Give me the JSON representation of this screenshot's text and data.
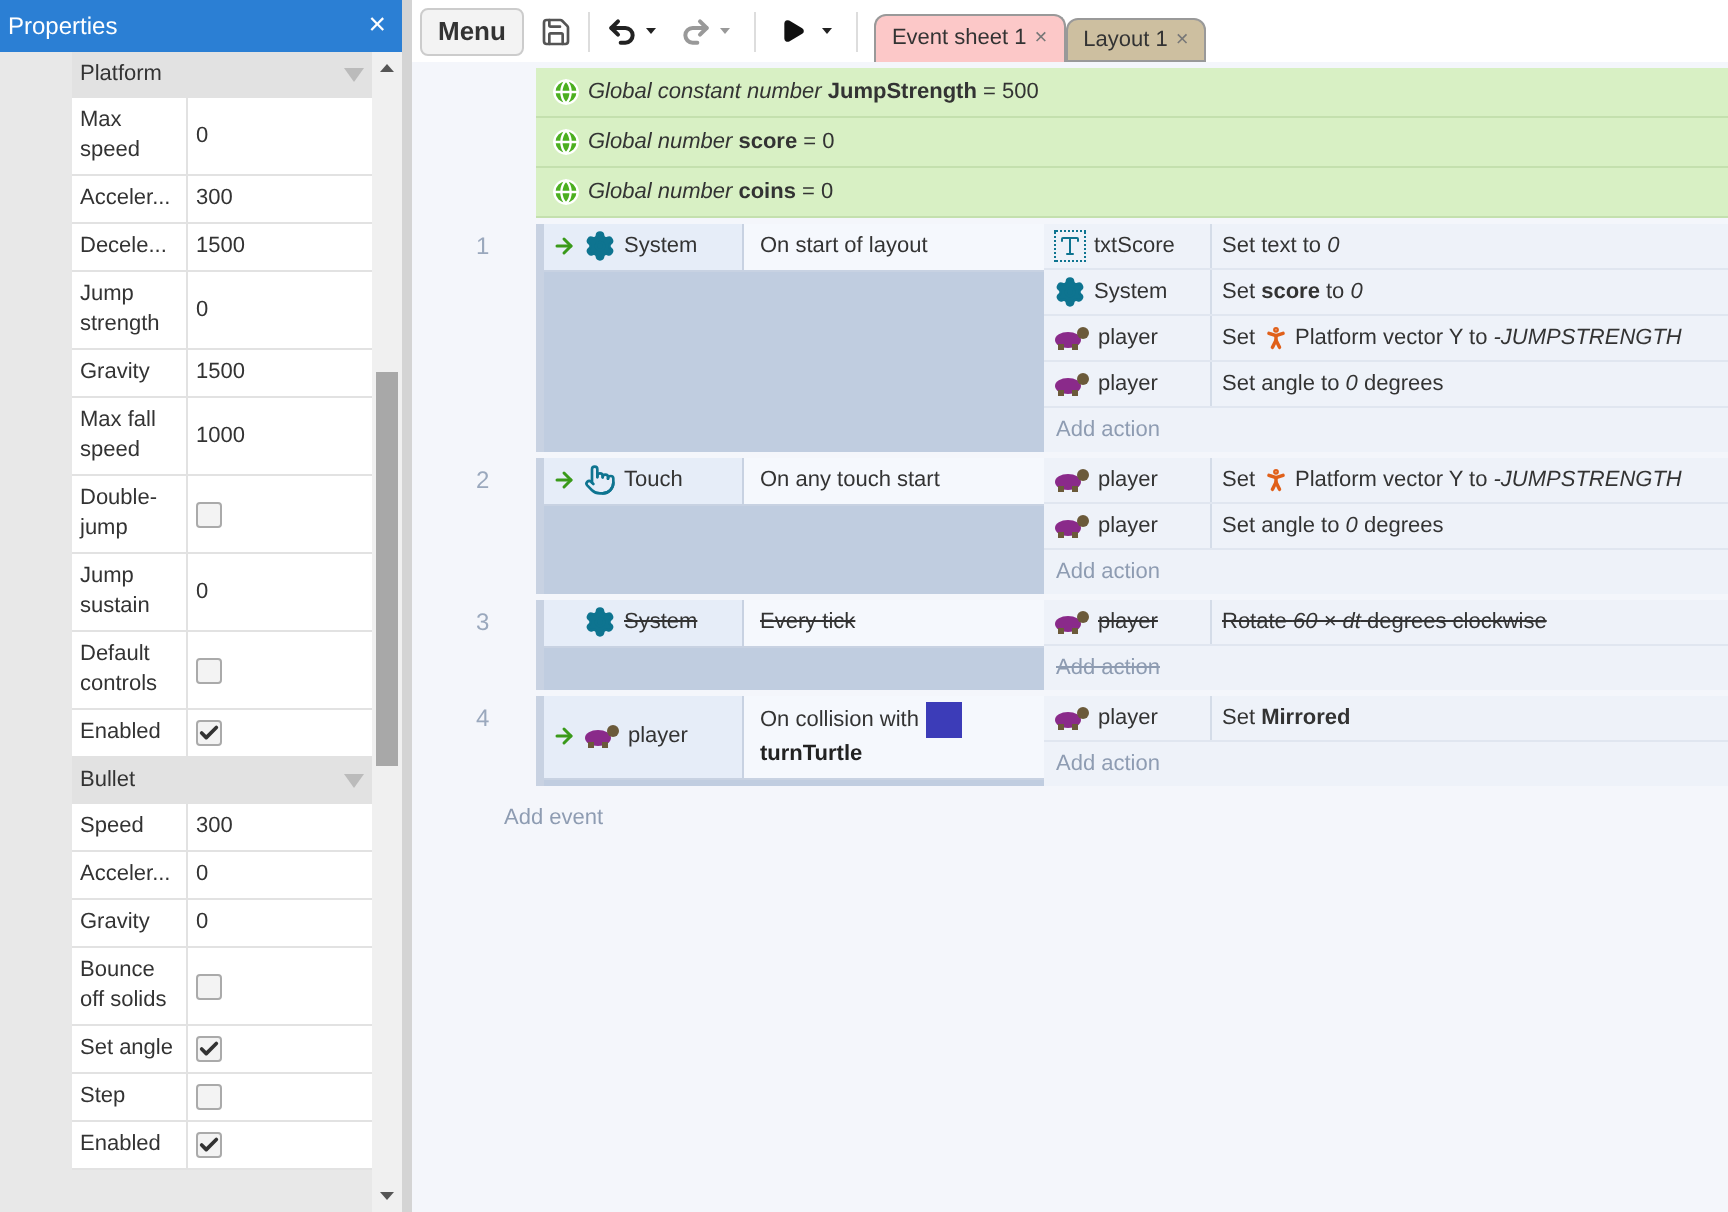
{
  "properties_panel": {
    "title": "Properties",
    "close": "×",
    "groups": [
      {
        "title": "Platform",
        "rows": [
          {
            "label": "Max speed",
            "kind": "text",
            "value": "0"
          },
          {
            "label": "Acceler...",
            "kind": "text",
            "value": "300"
          },
          {
            "label": "Decele...",
            "kind": "text",
            "value": "1500"
          },
          {
            "label": "Jump strength",
            "kind": "text",
            "value": "0"
          },
          {
            "label": "Gravity",
            "kind": "text",
            "value": "1500"
          },
          {
            "label": "Max fall speed",
            "kind": "text",
            "value": "1000"
          },
          {
            "label": "Double-jump",
            "kind": "checkbox",
            "checked": false
          },
          {
            "label": "Jump sustain",
            "kind": "text",
            "value": "0"
          },
          {
            "label": "Default controls",
            "kind": "checkbox",
            "checked": false
          },
          {
            "label": "Enabled",
            "kind": "checkbox",
            "checked": true
          }
        ]
      },
      {
        "title": "Bullet",
        "rows": [
          {
            "label": "Speed",
            "kind": "text",
            "value": "300"
          },
          {
            "label": "Acceler...",
            "kind": "text",
            "value": "0"
          },
          {
            "label": "Gravity",
            "kind": "text",
            "value": "0"
          },
          {
            "label": "Bounce off solids",
            "kind": "checkbox",
            "checked": false
          },
          {
            "label": "Set angle",
            "kind": "checkbox",
            "checked": true
          },
          {
            "label": "Step",
            "kind": "checkbox",
            "checked": false
          },
          {
            "label": "Enabled",
            "kind": "checkbox",
            "checked": true
          }
        ]
      }
    ]
  },
  "toolbar": {
    "menu": "Menu"
  },
  "tabs": [
    {
      "label": "Event sheet 1",
      "close": "×",
      "selected": true,
      "color": "#fcc8c8"
    },
    {
      "label": "Layout 1",
      "close": "×",
      "selected": false,
      "color": "#cdbfa0"
    }
  ],
  "globals": [
    "*Global constant number* **JumpStrength** = 500",
    "*Global number* **score** = 0",
    "*Global number* **coins** = 0"
  ],
  "events": [
    {
      "number": "1",
      "trigger": true,
      "disabled": false,
      "condition": {
        "object": "System",
        "kind": "gear",
        "text": "On start of layout"
      },
      "actions": [
        {
          "object": "txtScore",
          "kind": "text",
          "text": "Set text to *0*"
        },
        {
          "object": "System",
          "kind": "gear",
          "text": "Set **score** to *0*"
        },
        {
          "object": "player",
          "kind": "turtle",
          "verb": "Set",
          "text": "Platform vector Y to *-JUMPSTRENGTH*"
        },
        {
          "object": "player",
          "kind": "turtle",
          "text": "Set angle to *0* degrees"
        }
      ],
      "add_action": "Add action"
    },
    {
      "number": "2",
      "trigger": true,
      "disabled": false,
      "condition": {
        "object": "Touch",
        "kind": "touch",
        "text": "On any touch start"
      },
      "actions": [
        {
          "object": "player",
          "kind": "turtle",
          "verb": "Set",
          "text": "Platform vector Y to *-JUMPSTRENGTH*"
        },
        {
          "object": "player",
          "kind": "turtle",
          "text": "Set angle to *0* degrees"
        }
      ],
      "add_action": "Add action"
    },
    {
      "number": "3",
      "trigger": false,
      "disabled": true,
      "condition": {
        "object": "System",
        "kind": "gear",
        "text": "Every tick"
      },
      "actions": [
        {
          "object": "player",
          "kind": "turtle",
          "text": "Rotate *60 × dt* degrees clockwise"
        }
      ],
      "add_action": "Add action"
    },
    {
      "number": "4",
      "trigger": true,
      "disabled": false,
      "condition": {
        "object": "player",
        "kind": "turtle",
        "text": "On collision with",
        "param": "turnTurtle"
      },
      "actions": [
        {
          "object": "player",
          "kind": "turtle",
          "text": "Set **Mirrored**"
        }
      ],
      "add_action": "Add action"
    }
  ],
  "add_event": "Add event"
}
